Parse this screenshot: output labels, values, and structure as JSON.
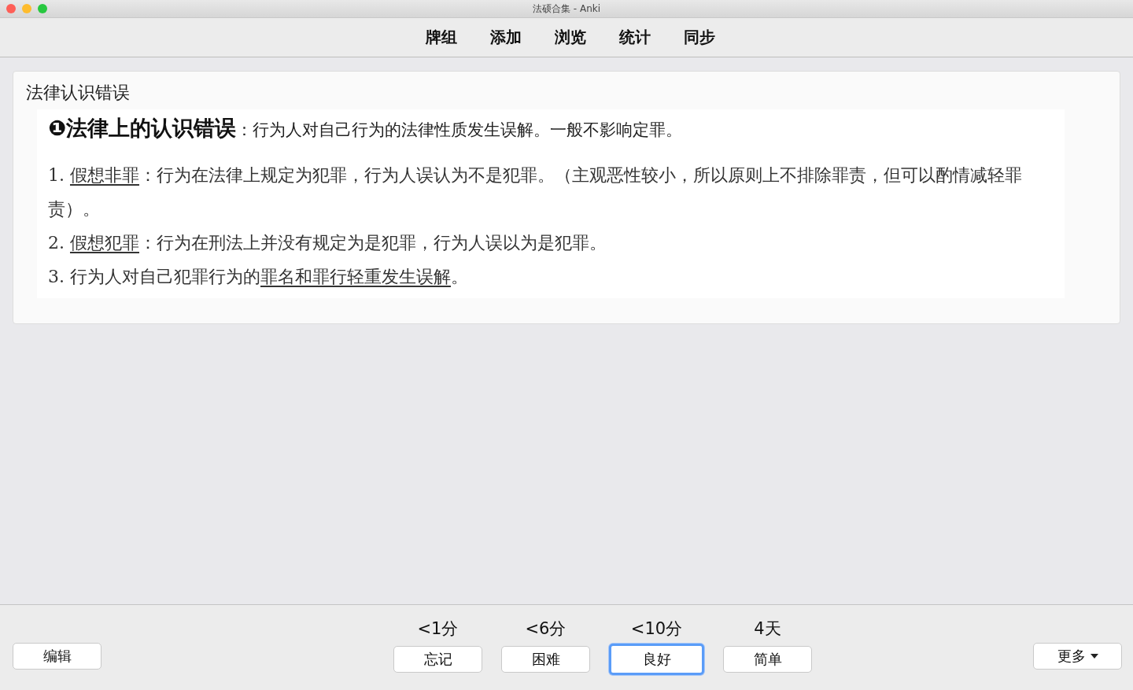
{
  "window": {
    "title": "法硕合集 - Anki"
  },
  "toolbar": [
    {
      "label": "牌组"
    },
    {
      "label": "添加"
    },
    {
      "label": "浏览"
    },
    {
      "label": "统计"
    },
    {
      "label": "同步"
    }
  ],
  "card": {
    "question": "法律认识错误",
    "answer": {
      "heading": "❶法律上的认识错误",
      "heading_rest": "：行为人对自己行为的法律性质发生误解。一般不影响定罪。",
      "items": [
        [
          {
            "text": "1. ",
            "kind": "plain"
          },
          {
            "text": "假想非罪",
            "kind": "underline"
          },
          {
            "text": "：行为在法律上规定为犯罪，行为人误认为不是犯罪。（主观恶性较小，所以原则上不排除罪责，但可以酌情减轻罪责）。",
            "kind": "plain"
          }
        ],
        [
          {
            "text": "2. ",
            "kind": "plain"
          },
          {
            "text": "假想犯罪",
            "kind": "underline"
          },
          {
            "text": "：行为在刑法上并没有规定为是犯罪，行为人误以为是犯罪。",
            "kind": "plain"
          }
        ],
        [
          {
            "text": "3. 行为人对自己犯罪行为的",
            "kind": "plain"
          },
          {
            "text": "罪名和罪行轻重发生误解",
            "kind": "underline"
          },
          {
            "text": "。",
            "kind": "plain"
          }
        ]
      ]
    }
  },
  "bottom": {
    "edit": "编辑",
    "more": "更多",
    "answers": [
      {
        "interval": "<1分",
        "label": "忘记",
        "selected": false
      },
      {
        "interval": "<6分",
        "label": "困难",
        "selected": false
      },
      {
        "interval": "<10分",
        "label": "良好",
        "selected": true
      },
      {
        "interval": "4天",
        "label": "简单",
        "selected": false
      }
    ]
  }
}
